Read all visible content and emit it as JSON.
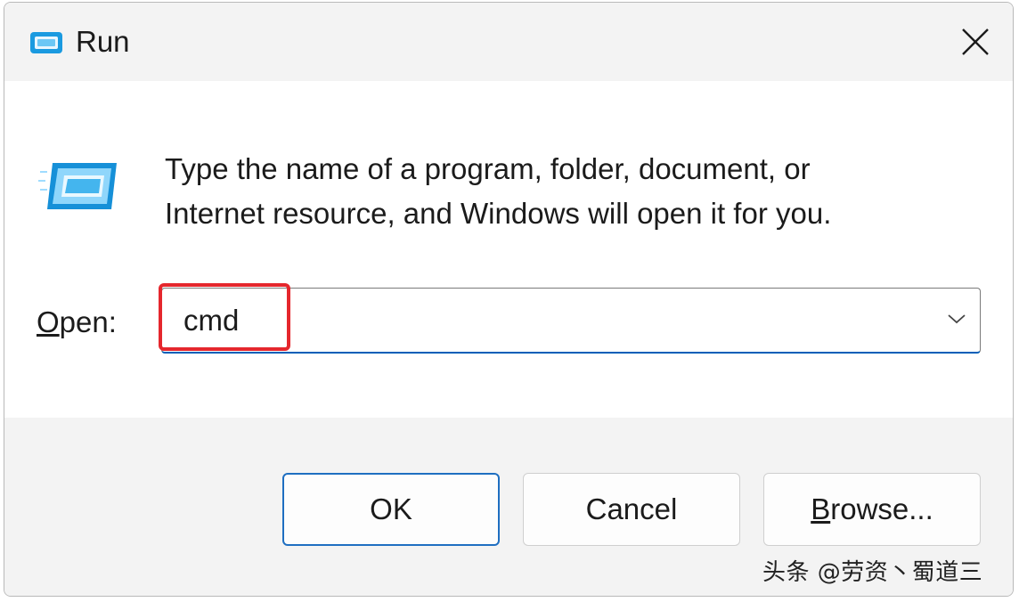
{
  "window": {
    "title": "Run",
    "close_icon": "close-icon",
    "app_icon": "run-app-icon"
  },
  "content": {
    "description_line1": "Type the name of a program, folder, document, or",
    "description_line2": "Internet resource, and Windows will open it for you.",
    "open_label_underlined": "O",
    "open_label_rest": "pen:",
    "open_value": "cmd",
    "dropdown_icon": "chevron-down-icon"
  },
  "buttons": {
    "ok_label": "OK",
    "cancel_label": "Cancel",
    "browse_label_underlined": "B",
    "browse_label_rest": "rowse..."
  },
  "watermark": "头条 @劳资丶蜀道三",
  "colors": {
    "accent": "#005fb8",
    "highlight": "#e5272d",
    "titlebar": "#f3f3f3",
    "footer": "#f3f3f3"
  }
}
